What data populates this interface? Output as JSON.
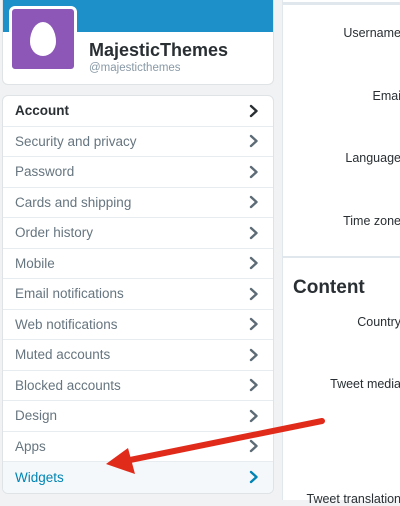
{
  "profile": {
    "name": "MajesticThemes",
    "handle": "@majesticthemes"
  },
  "menu": [
    {
      "key": "account",
      "label": "Account"
    },
    {
      "key": "security",
      "label": "Security and privacy"
    },
    {
      "key": "password",
      "label": "Password"
    },
    {
      "key": "cards",
      "label": "Cards and shipping"
    },
    {
      "key": "orders",
      "label": "Order history"
    },
    {
      "key": "mobile",
      "label": "Mobile"
    },
    {
      "key": "email",
      "label": "Email notifications"
    },
    {
      "key": "web",
      "label": "Web notifications"
    },
    {
      "key": "muted",
      "label": "Muted accounts"
    },
    {
      "key": "blocked",
      "label": "Blocked accounts"
    },
    {
      "key": "design",
      "label": "Design"
    },
    {
      "key": "apps",
      "label": "Apps"
    },
    {
      "key": "widgets",
      "label": "Widgets"
    }
  ],
  "settings": {
    "username_label": "Username",
    "email_label": "Emai",
    "language_label": "Language",
    "timezone_label": "Time zone",
    "content_title": "Content",
    "country_label": "Country",
    "tweet_media_label": "Tweet media",
    "tweet_translation_label": "Tweet translation"
  },
  "colors": {
    "banner": "#1d8fc9",
    "avatar_bg": "#8c57b7",
    "link": "#0084b4",
    "annotation_arrow": "#e02b1b"
  },
  "icons": {
    "chevron": "chevron-right-icon",
    "avatar": "egg-avatar-icon"
  }
}
